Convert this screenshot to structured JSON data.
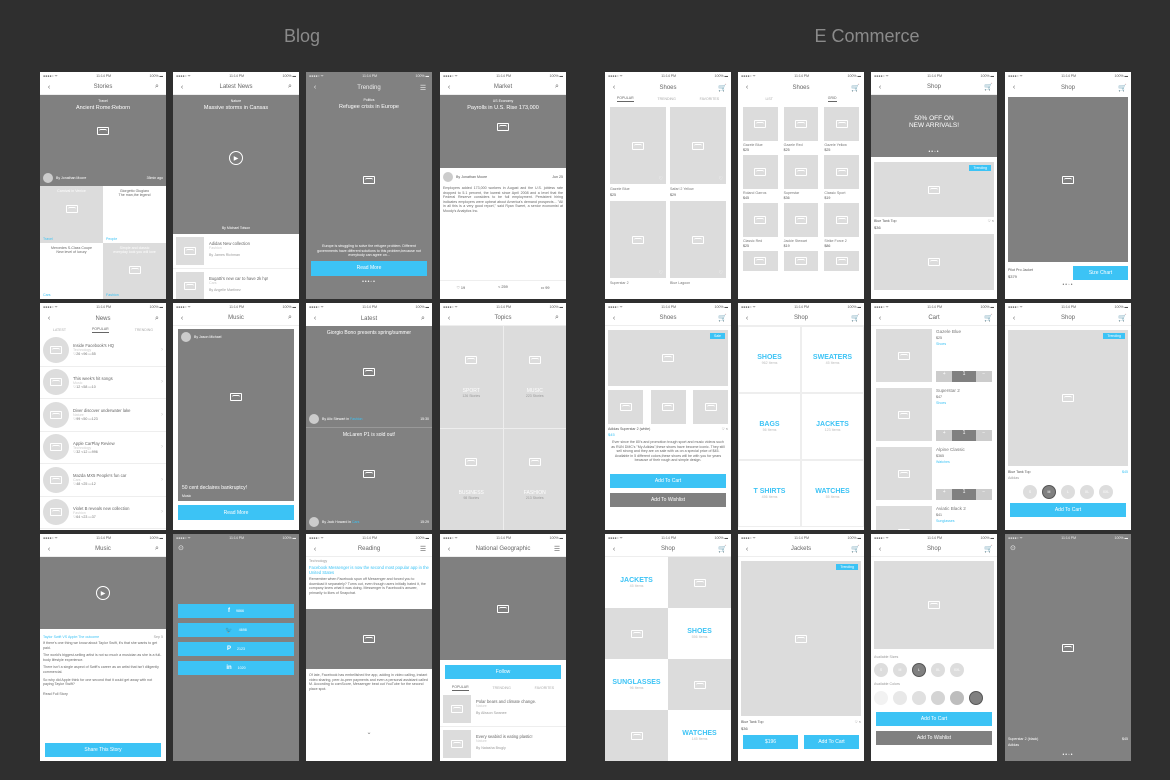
{
  "sections": {
    "blog": "Blog",
    "ecommerce": "E Commerce"
  },
  "status": {
    "carrier": "●●●●○ ᯤ",
    "time": "11:14 PM",
    "battery": "100% ▬"
  },
  "blog": {
    "stories": {
      "title": "Stories",
      "category": "Travel",
      "headline": "Ancient Rome:Reborn",
      "author": "By Jonathan Moore",
      "time": "35min ago",
      "tiles": [
        {
          "title": "Carnival in Venice",
          "tag": "Travel"
        },
        {
          "title": "Giorgetto Giugiaro\nThe man,the legend",
          "tag": "People"
        },
        {
          "title": "Mercedes S-Class Coupe\nNew level of luxury",
          "tag": "Cars"
        },
        {
          "title": "Simple and classic\neveryday look you will love",
          "tag": "Fashion"
        }
      ]
    },
    "latest_news": {
      "title": "Latest News",
      "category": "Nature",
      "headline": "Massive storms in Cansas",
      "author": "By Michael Totson",
      "items": [
        {
          "title": "Adidas New collection",
          "tag": "Fashion",
          "author": "By James Richman"
        },
        {
          "title": "Bugatti's new car to have 2k hp!",
          "tag": "Cars",
          "author": "By Angelle Martinez"
        }
      ]
    },
    "trending": {
      "title": "Trending",
      "category": "Politics",
      "headline": "Refugee crisis in Europe",
      "body": "Europe is struggling to solve the refugee problem. Different governments have different solutions to this problem,because not everybody can agree on...",
      "button": "Read More"
    },
    "market": {
      "title": "Market",
      "category": "US Economy",
      "headline": "Payrolls in U.S. Rise 173,000",
      "author": "By Jonathan Moore",
      "date": "Jun 25",
      "body": "Employers added 173,000 workers in August and the U.S. jobless rate dropped to 5.1 percent, the lowest since April 2008 and a level that the Federal Reserve considers to be full employment. Persistent hiring indicates employers were upbeat about America's demand prospects... \"All in all this is a very good report,\" said Ryan Sweet, a senior economist at Moody's Analytics Inc.",
      "likes": "19",
      "shares": "259",
      "comments": "99"
    },
    "news": {
      "title": "News",
      "tabs": [
        "LATEST",
        "POPULAR",
        "TRENDING"
      ],
      "items": [
        {
          "title": "Inside Facebook's HQ",
          "tag": "Technology",
          "likes": "26",
          "shares": "96",
          "comments": "55"
        },
        {
          "title": "This week's hit songs",
          "tag": "Music",
          "likes": "12",
          "shares": "58",
          "comments": "10"
        },
        {
          "title": "Diver discover underwater lake",
          "tag": "Nature",
          "likes": "99",
          "shares": "50",
          "comments": "123"
        },
        {
          "title": "Apple CarPlay Review",
          "tag": "Technology",
          "likes": "32",
          "shares": "12",
          "comments": "996"
        },
        {
          "title": "Mazda MX5 People's fun car",
          "tag": "Cars",
          "likes": "48",
          "shares": "25",
          "comments": "12"
        },
        {
          "title": "Violet B reveals new collection",
          "tag": "Fashion",
          "likes": "64",
          "shares": "23",
          "comments": "37"
        }
      ]
    },
    "music": {
      "title": "Music",
      "author": "By Jason Michael",
      "headline": "50 cent declaires bankruptcy!",
      "tag": "Music",
      "button": "Read More"
    },
    "latest": {
      "title": "Latest",
      "items": [
        {
          "headline": "Giorgio Bono presents spring/summer",
          "author": "By Alic Stewart in",
          "tag": "Fashion",
          "time": "15:30"
        },
        {
          "headline": "McLaren P1 is sold out!",
          "author": "By Jack Howard in",
          "tag": "Cars",
          "time": "15:29"
        }
      ]
    },
    "topics": {
      "title": "Topics",
      "items": [
        {
          "name": "SPORT",
          "count": "126 Stories"
        },
        {
          "name": "MUSIC",
          "count": "223 Stories"
        },
        {
          "name": "BUSINESS",
          "count": "98 Stories"
        },
        {
          "name": "FASHION",
          "count": "213 Stories"
        }
      ]
    },
    "music_article": {
      "title": "Music",
      "headline": "Taylor Swift VS Apple:The outcome",
      "date": "Sep 5",
      "body": [
        "If there's one thing we know about Taylor Swift, it's that she wants to get paid.",
        "The world's biggest-selling artist is not so much a musician as she is a full-body lifestyle experience.",
        "There isn't a single aspect of Swift's career as an artist that isn't diligently commercial.",
        "So why did Apple think for one second that it could get away with not paying Taylor Swift?"
      ],
      "read_full": "Read Full Story",
      "button": "Share This Story"
    },
    "share": {
      "items": [
        {
          "icon": "f",
          "name": "facebook",
          "count": "9866"
        },
        {
          "icon": "🐦",
          "name": "twitter",
          "count": "4698"
        },
        {
          "icon": "P",
          "name": "pinterest",
          "count": "2123"
        },
        {
          "icon": "in",
          "name": "linkedin",
          "count": "1020"
        }
      ]
    },
    "reading": {
      "title": "Reading",
      "category": "Technology",
      "headline": "Facebook Messenger is now the second most popular app in the United States",
      "body1": "Remember when Facebook spun off Messenger and forced you to download it separately? Turns out, even though users initially hated it, the company knew what it was doing. Messenger is Facebook's answer, primarily to likes of Snapchat.",
      "body2": "Of late, Facebook has embellished the app, adding in video calling, instant video sharing, peer-to-peer payments and even a personal assistant called M. According to comScore, Messenger beat out YouTube for the second place spot."
    },
    "natgeo": {
      "title": "National Geographic",
      "button": "Follow",
      "tabs": [
        "POPULAR",
        "TRENDING",
        "FAVORITES"
      ],
      "items": [
        {
          "title": "Polar bears and climate change.",
          "tag": "Nature",
          "author": "By Alisson Swanee"
        },
        {
          "title": "Every seabird is eating plastic!",
          "tag": "Nature",
          "author": "By Natasha Brugly"
        }
      ]
    }
  },
  "ecommerce": {
    "shoes_popular": {
      "title": "Shoes",
      "tabs": [
        "POPULAR",
        "TRENDING",
        "FAVORITES"
      ],
      "items": [
        {
          "name": "Gazele Blue",
          "price": "$25"
        },
        {
          "name": "Safari 2 Yellow",
          "price": "$29"
        },
        {
          "name": "Superstar 2",
          "price": ""
        },
        {
          "name": "Blue Lagoon",
          "price": ""
        }
      ]
    },
    "shoes_grid": {
      "title": "Shoes",
      "tabs": [
        "LIST",
        "GRID"
      ],
      "items": [
        {
          "name": "Gazele Blue",
          "price": "$25"
        },
        {
          "name": "Gazele Red",
          "price": "$25"
        },
        {
          "name": "Gazele Yellow",
          "price": "$25"
        },
        {
          "name": "Roland Garros",
          "price": "$45"
        },
        {
          "name": "Superstar",
          "price": "$36"
        },
        {
          "name": "Classic Sport",
          "price": "$19"
        },
        {
          "name": "Classic Red",
          "price": "$25"
        },
        {
          "name": "Jackie Stewart",
          "price": "$19"
        },
        {
          "name": "Strike Force 2",
          "price": "$86"
        }
      ]
    },
    "shop_promo": {
      "title": "Shop",
      "banner": "50% OFF ON\nNEW ARRIVALS!",
      "badge": "Trending",
      "product": "Blue Tank Top",
      "price": "$36"
    },
    "shop_jacket": {
      "title": "Shop",
      "product": "Pilot Pro Jacket",
      "price": "$379",
      "button": "Size Chart"
    },
    "shoe_detail": {
      "title": "Shoes",
      "badge": "Sale",
      "product": "Adidas Superstar 2 (white)",
      "price": "$45",
      "body": "Ever since the 80's and promotion trough sport and music videos such as RUN DMC's \"My Adidas\",these shoes have become iconic. They still sell strong and they are on sale with us on a special price of $45. Available in 5 different colors,these shoes will be with you for years because of their rough and simple design.",
      "cart": "Add To Cart",
      "wishlist": "Add To Wishlist"
    },
    "shop_categories": {
      "title": "Shop",
      "items": [
        {
          "name": "SHOES",
          "count": "962 Items"
        },
        {
          "name": "SWEATERS",
          "count": "45 Items"
        },
        {
          "name": "BAGS",
          "count": "56 Items"
        },
        {
          "name": "JACKETS",
          "count": "123 Items"
        },
        {
          "name": "T SHIRTS",
          "count": "456 Items"
        },
        {
          "name": "WATCHES",
          "count": "55 Items"
        }
      ]
    },
    "cart": {
      "title": "Cart",
      "items": [
        {
          "name": "Gazele Blue",
          "price": "$25",
          "cat": "Shoes",
          "qty": "1"
        },
        {
          "name": "Superstar 2",
          "price": "$47",
          "cat": "Shoes",
          "qty": "1"
        },
        {
          "name": "Alpine Classic",
          "price": "$365",
          "cat": "Watches",
          "qty": "1"
        },
        {
          "name": "Aviatic Black 2",
          "price": "$41",
          "cat": "Sunglasses",
          "qty": "1"
        }
      ]
    },
    "shop_sizes": {
      "title": "Shop",
      "badge": "Trending",
      "product": "Blue Tank Top",
      "brand": "Adidas",
      "price": "$45",
      "sizes": [
        "S",
        "M",
        "L",
        "XL",
        "XXL"
      ],
      "selected": "M",
      "button": "Add To Cart"
    },
    "shop_alt": {
      "title": "Shop",
      "items": [
        {
          "name": "JACKETS",
          "count": "45 Items"
        },
        {
          "name": "SHOES",
          "count": "556 Items"
        },
        {
          "name": "SUNGLASSES",
          "count": "96 Items"
        },
        {
          "name": "WATCHES",
          "count": "145 Items"
        }
      ]
    },
    "jackets": {
      "title": "Jackets",
      "badge": "Trending",
      "product": "Blue Tank Top",
      "price": "$36",
      "price_btn": "$196",
      "button": "Add To Cart"
    },
    "shop_options": {
      "title": "Shop",
      "sizes_label": "Available Sizes",
      "sizes": [
        "S",
        "M",
        "L",
        "XL",
        "XXL"
      ],
      "selected": "L",
      "colors_label": "Available Colors",
      "colors": [
        "#f2f2f2",
        "#e8e8e8",
        "#e0e0e0",
        "#d4d4d4",
        "#bdbdbd",
        "#808080"
      ],
      "cart": "Add To Cart",
      "wishlist": "Add To Wishlist"
    },
    "fullscreen": {
      "product": "Superstar 2 (black)",
      "brand": "Adidas",
      "price": "$45"
    }
  }
}
